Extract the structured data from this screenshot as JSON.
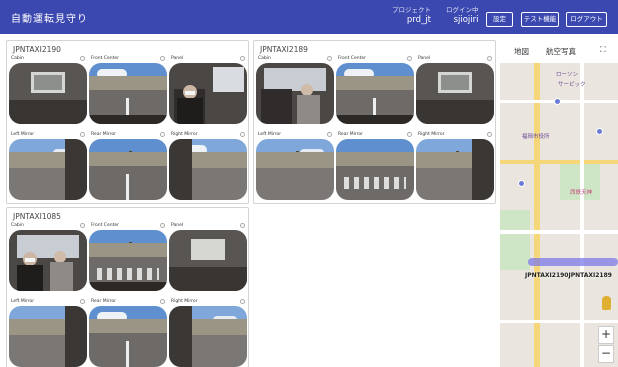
{
  "header": {
    "title": "自動運転見守り",
    "project_label": "プロジェクト",
    "project_value": "prd_jt",
    "user_label": "ログイン中",
    "user_value": "sjiojiri",
    "buttons": [
      "設定",
      "テスト機能",
      "ログアウト"
    ]
  },
  "cars": [
    {
      "name": "JPNTAXI2190",
      "cameras": [
        "Cabin",
        "Front Center",
        "Panel",
        "Left Mirror",
        "Rear Mirror",
        "Right Mirror"
      ]
    },
    {
      "name": "JPNTAXI2189",
      "cameras": [
        "Cabin",
        "Front Center",
        "Panel",
        "Left Mirror",
        "Rear Mirror",
        "Right Mirror"
      ]
    },
    {
      "name": "JPNTAXI1085",
      "cameras": [
        "Cabin",
        "Front Center",
        "Panel",
        "Left Mirror",
        "Rear Mirror",
        "Right Mirror"
      ]
    }
  ],
  "map": {
    "tabs": [
      "地図",
      "航空写真"
    ],
    "labels": [
      "ローソン",
      "サーピック",
      "福岡市役所",
      "西鉄天神"
    ],
    "car_marker": "JPNTAXI2190JPNTAXI2189",
    "zoom_in": "+",
    "zoom_out": "−",
    "fullscreen_icon": "⛶"
  }
}
